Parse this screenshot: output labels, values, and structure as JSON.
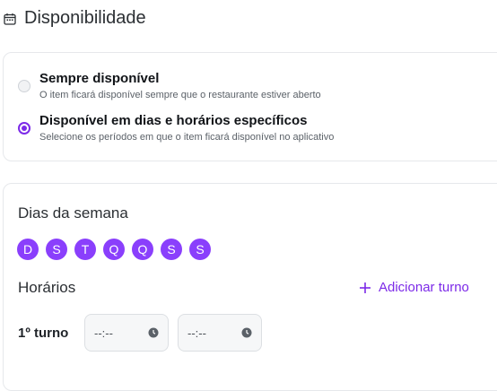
{
  "header": {
    "title": "Disponibilidade",
    "icon": "calendar-icon"
  },
  "availability": {
    "options": [
      {
        "title": "Sempre disponível",
        "subtitle": "O item ficará disponível sempre que o restaurante estiver aberto",
        "selected": false
      },
      {
        "title": "Disponível em dias e horários específicos",
        "subtitle": "Selecione os períodos em que o item ficará disponível no aplicativo",
        "selected": true
      }
    ]
  },
  "schedule": {
    "days_title": "Dias da semana",
    "days": [
      "D",
      "S",
      "T",
      "Q",
      "Q",
      "S",
      "S"
    ],
    "hours_title": "Horários",
    "add_shift_label": "Adicionar turno",
    "shift": {
      "label": "1º turno",
      "start": "--:--",
      "end": "--:--"
    }
  },
  "colors": {
    "accent": "#7c2ae8",
    "day_chip": "#8a3ffc"
  }
}
